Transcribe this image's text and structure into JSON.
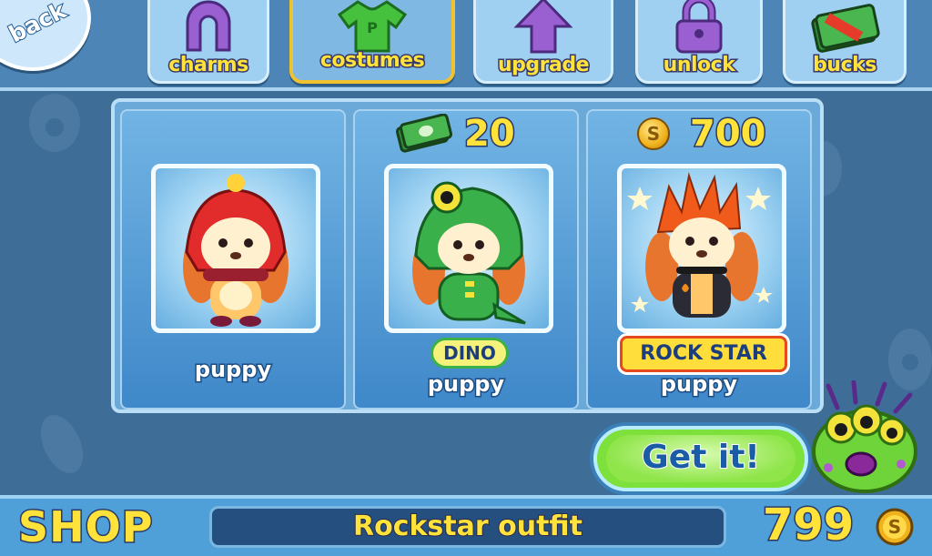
{
  "nav": {
    "back_label": "back"
  },
  "tabs": [
    {
      "label": "charms",
      "icon": "horseshoe-icon",
      "active": false
    },
    {
      "label": "costumes",
      "icon": "shirt-icon",
      "active": true
    },
    {
      "label": "upgrade",
      "icon": "arrow-up-icon",
      "active": false
    },
    {
      "label": "unlock",
      "icon": "lock-icon",
      "active": false
    },
    {
      "label": "bucks",
      "icon": "cash-icon",
      "active": false
    }
  ],
  "cards": [
    {
      "pet": "puppy",
      "costume_tag": "",
      "price": "",
      "currency": "",
      "outfit": "red-hood"
    },
    {
      "pet": "puppy",
      "costume_tag": "DINO",
      "price": "20",
      "currency": "bucks-icon",
      "outfit": "dino"
    },
    {
      "pet": "puppy",
      "costume_tag": "ROCK STAR",
      "price": "700",
      "currency": "coin-icon",
      "outfit": "rockstar"
    }
  ],
  "action": {
    "buy_label": "Get it!"
  },
  "footer": {
    "title": "SHOP",
    "selected_item": "Rockstar outfit",
    "balance": "799",
    "balance_currency": "coin-icon"
  },
  "colors": {
    "label_yellow": "#ffe23a",
    "accent_green": "#7ee03a",
    "active_tab_border": "#f2c12e",
    "panel_blue": "#6aa9d8"
  }
}
